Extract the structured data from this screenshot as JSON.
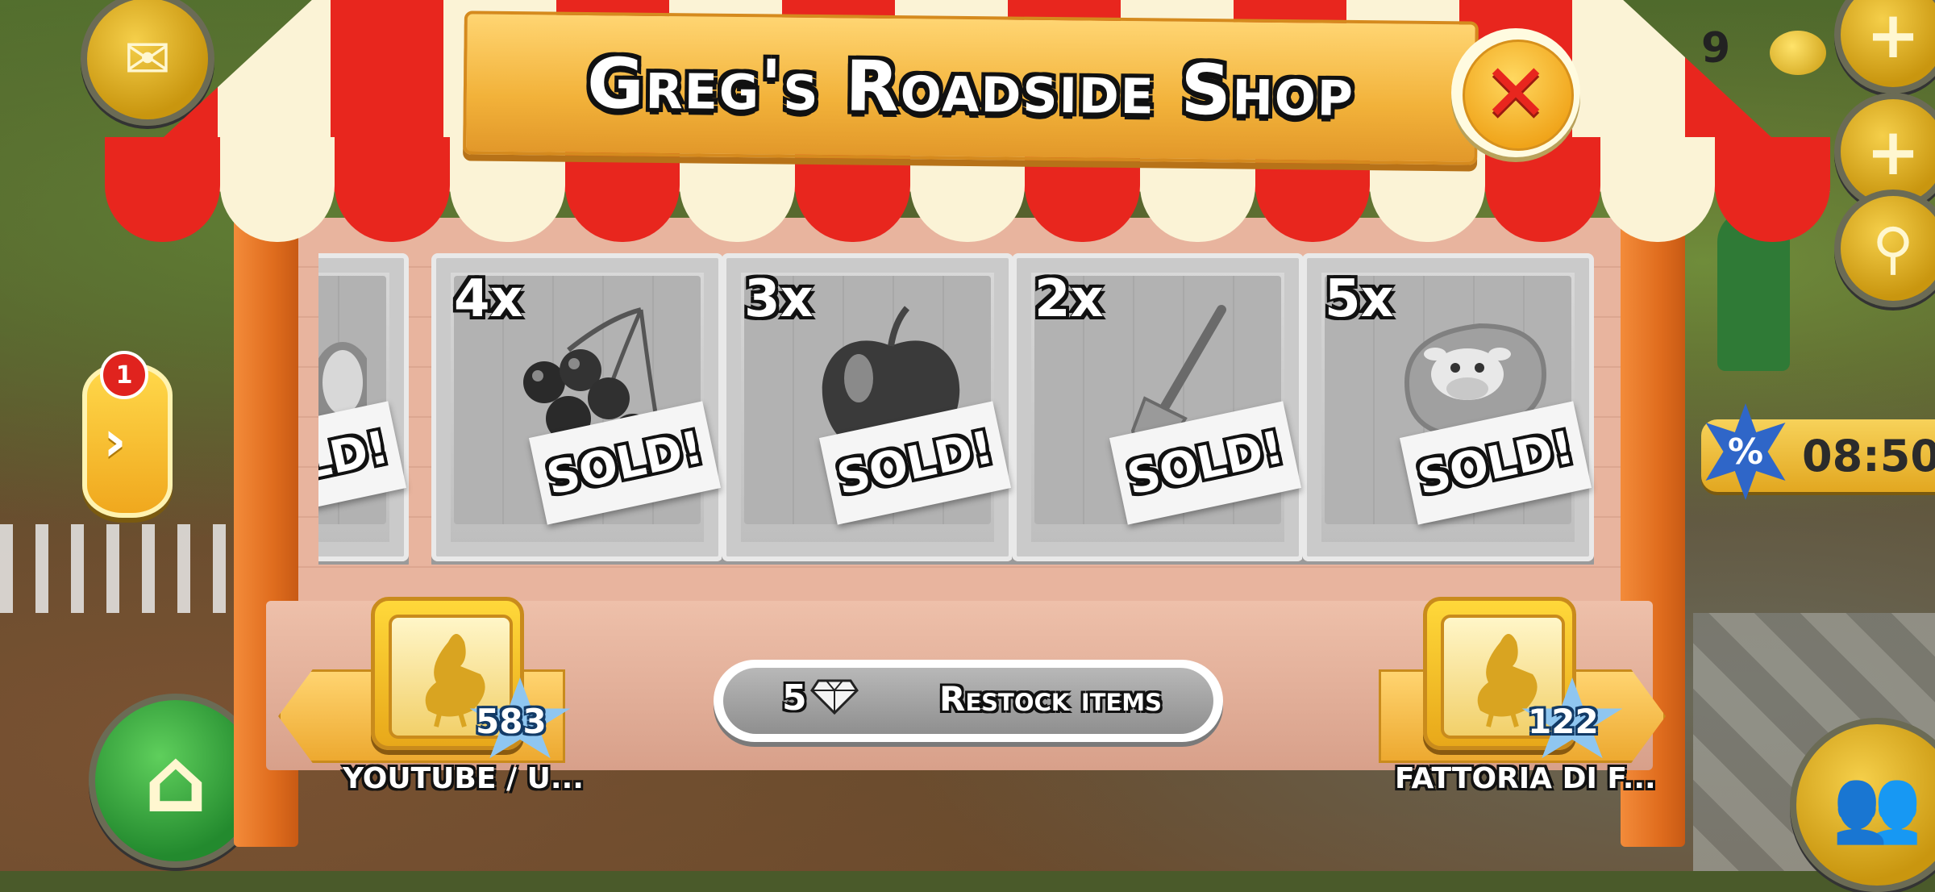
{
  "shop": {
    "title": "Greg's Roadside Shop",
    "close_symbol": "✕",
    "crates": [
      {
        "qty": "",
        "sold_label": "SOLD!",
        "icon": "partial-item-icon"
      },
      {
        "qty": "4x",
        "sold_label": "SOLD!",
        "icon": "cherries-icon"
      },
      {
        "qty": "3x",
        "sold_label": "SOLD!",
        "icon": "apple-icon"
      },
      {
        "qty": "2x",
        "sold_label": "SOLD!",
        "icon": "shovel-icon"
      },
      {
        "qty": "5x",
        "sold_label": "SOLD!",
        "icon": "cow-blanket-icon"
      }
    ],
    "restock": {
      "cost": "5",
      "label": "Restock items",
      "icon": "diamond-icon"
    }
  },
  "neighbors": {
    "left": {
      "name": "YOUTUBE / U...",
      "level": "583",
      "icon": "rooster-icon"
    },
    "right": {
      "name": "FATTORIA DI F...",
      "level": "122",
      "icon": "rooster-icon"
    }
  },
  "hud": {
    "side_badge": "1",
    "side_arrow": "›",
    "timer": "08:50",
    "discount_symbol": "%",
    "coins_partial": "9"
  },
  "colors": {
    "awning_red": "#e8261e",
    "awning_cream": "#fbf3d6",
    "sign_gold": "#f2b23a",
    "post_orange": "#e06d1e",
    "crate_gray": "#bdbdbd"
  }
}
